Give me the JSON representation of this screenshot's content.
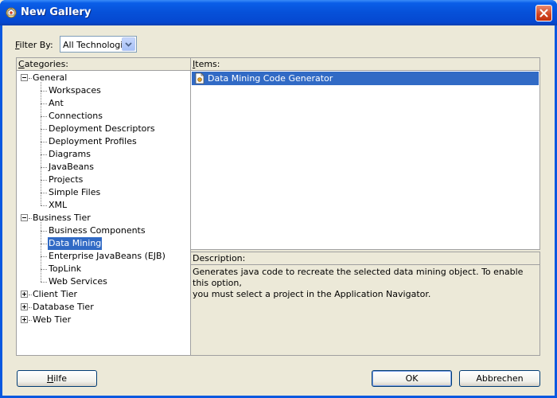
{
  "window": {
    "title": "New Gallery",
    "icon": "gallery-icon",
    "close_icon": "close-icon"
  },
  "filter": {
    "label_hotkey": "F",
    "label_rest": "ilter By:",
    "selected": "All Technologies"
  },
  "categories": {
    "header_hotkey": "C",
    "header_rest": "ategories:",
    "tree": [
      {
        "label": "General",
        "level": 0,
        "expander": "minus"
      },
      {
        "label": "Workspaces",
        "level": 1
      },
      {
        "label": "Ant",
        "level": 1
      },
      {
        "label": "Connections",
        "level": 1
      },
      {
        "label": "Deployment Descriptors",
        "level": 1
      },
      {
        "label": "Deployment Profiles",
        "level": 1
      },
      {
        "label": "Diagrams",
        "level": 1
      },
      {
        "label": "JavaBeans",
        "level": 1
      },
      {
        "label": "Projects",
        "level": 1
      },
      {
        "label": "Simple Files",
        "level": 1
      },
      {
        "label": "XML",
        "level": 1
      },
      {
        "label": "Business Tier",
        "level": 0,
        "expander": "minus"
      },
      {
        "label": "Business Components",
        "level": 1
      },
      {
        "label": "Data Mining",
        "level": 1,
        "selected": true
      },
      {
        "label": "Enterprise JavaBeans (EJB)",
        "level": 1
      },
      {
        "label": "TopLink",
        "level": 1
      },
      {
        "label": "Web Services",
        "level": 1
      },
      {
        "label": "Client Tier",
        "level": 0,
        "expander": "plus"
      },
      {
        "label": "Database Tier",
        "level": 0,
        "expander": "plus"
      },
      {
        "label": "Web Tier",
        "level": 0,
        "expander": "plus"
      }
    ]
  },
  "items": {
    "header_hotkey": "I",
    "header_rest": "tems:",
    "list": [
      {
        "label": "Data Mining Code Generator",
        "icon": "code-generator-icon",
        "selected": true
      }
    ]
  },
  "description": {
    "header": "Description:",
    "text_line1": "Generates java code to recreate the selected data mining object. To enable this option,",
    "text_line2": "you must select a project in the Application Navigator."
  },
  "buttons": {
    "help_pre": "",
    "help_hotkey": "H",
    "help_rest": "ilfe",
    "ok": "OK",
    "cancel": "Abbrechen"
  },
  "colors": {
    "selection": "#316ac5",
    "titlebar": "#0650d8",
    "dialog_bg": "#ece9d8"
  }
}
